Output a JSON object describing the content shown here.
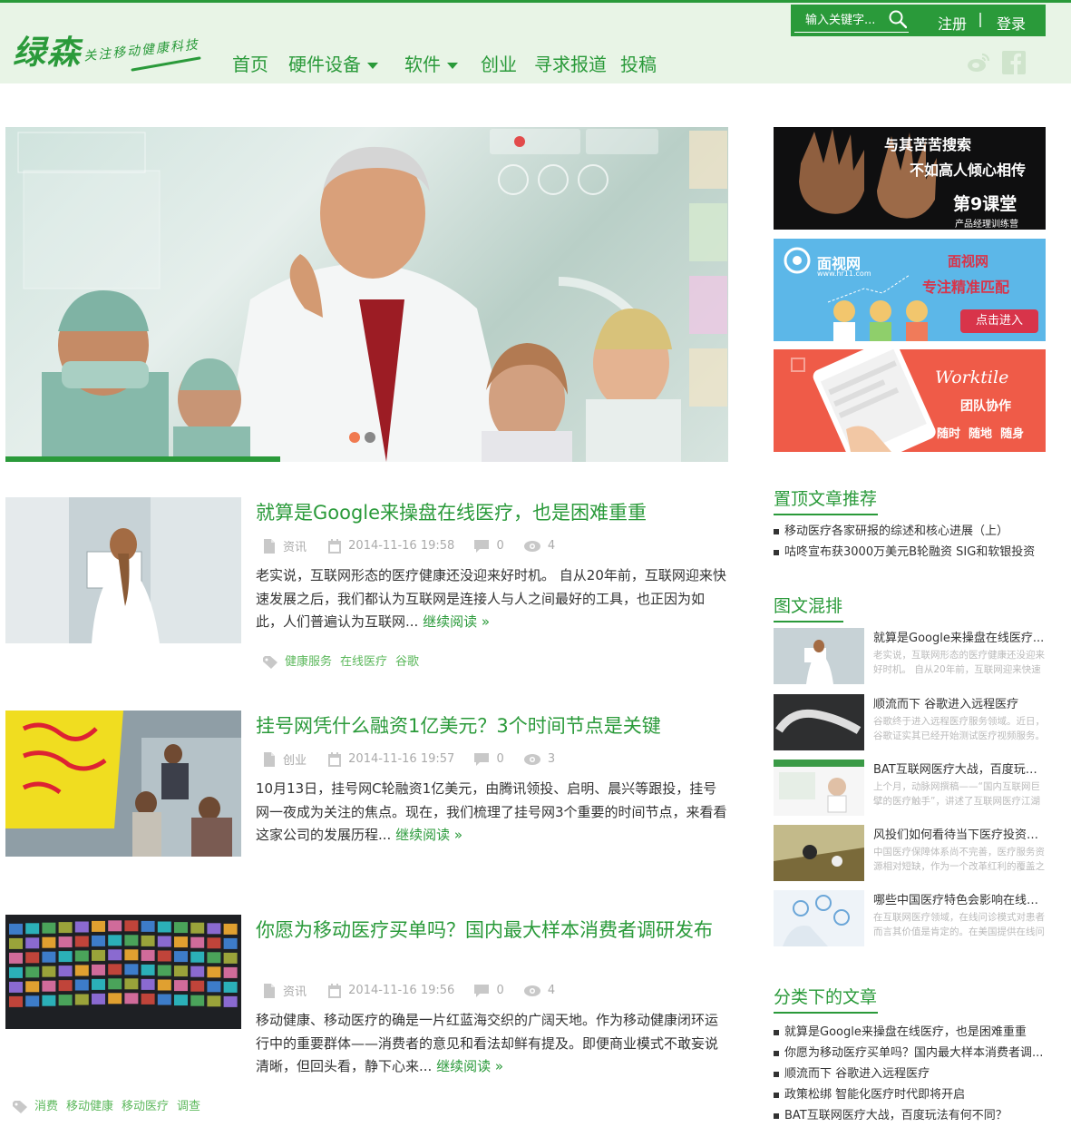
{
  "brand": {
    "name": "绿森",
    "tagline": "关注移动健康科技"
  },
  "nav": [
    {
      "label": "首页"
    },
    {
      "label": "硬件设备"
    },
    {
      "label": "软件"
    },
    {
      "label": "创业"
    },
    {
      "label": "寻求报道"
    },
    {
      "label": "投稿"
    }
  ],
  "search": {
    "placeholder": "输入关键字..."
  },
  "auth": {
    "register": "注册",
    "login": "登录"
  },
  "colors": {
    "accent": "#2a9a3a",
    "header_bg": "#e8f4e6",
    "tag": "#5cb85c"
  },
  "slider": {
    "progress": 0.38,
    "active_index": 0,
    "count": 2
  },
  "posts": [
    {
      "title": "就算是Google来操盘在线医疗，也是困难重重",
      "category": "资讯",
      "date": "2014-11-16 19:58",
      "comments": "0",
      "views": "4",
      "excerpt": "老实说，互联网形态的医疗健康还没迎来好时机。 自从20年前，互联网迎来快速发展之后，我们都认为互联网是连接人与人之间最好的工具，也正因为如此，人们普遍认为互联网...",
      "readmore": "继续阅读 »",
      "tags": [
        "健康服务",
        "在线医疗",
        "谷歌"
      ]
    },
    {
      "title": "挂号网凭什么融资1亿美元？3个时间节点是关键",
      "category": "创业",
      "date": "2014-11-16 19:57",
      "comments": "0",
      "views": "3",
      "excerpt": "10月13日，挂号网C轮融资1亿美元，由腾讯领投、启明、晨兴等跟投，挂号网一夜成为关注的焦点。现在，我们梳理了挂号网3个重要的时间节点，来看看这家公司的发展历程...",
      "readmore": "继续阅读 »",
      "tags": []
    },
    {
      "title": "你愿为移动医疗买单吗？国内最大样本消费者调研发布",
      "category": "资讯",
      "date": "2014-11-16 19:56",
      "comments": "0",
      "views": "4",
      "excerpt": "移动健康、移动医疗的确是一片红蓝海交织的广阔天地。作为移动健康闭环运行中的重要群体——消费者的意见和看法却鲜有提及。即便商业模式不敢妄说清晰，但回头看，静下心来...",
      "readmore": "继续阅读 »",
      "tags": [
        "消费",
        "移动健康",
        "移动医疗",
        "调查"
      ]
    }
  ],
  "ads": [
    {
      "line1": "与其苦苦搜索",
      "line2": "不如高人倾心相传",
      "line3": "第9课堂",
      "line4": "产品经理训练营"
    },
    {
      "line1": "面视网",
      "line2": "www.hr11.com",
      "line3": "面视网",
      "line4": "专注精准匹配",
      "line5": "点击进入"
    },
    {
      "line1": "Worktile",
      "line2": "团队协作",
      "line3": "随时  随地  随身"
    }
  ],
  "sidebar": {
    "pinned_title": "置顶文章推荐",
    "pinned": [
      "移动医疗各家研报的综述和核心进展（上）",
      "咕咚宣布获3000万美元B轮融资 SIG和软银投资"
    ],
    "mix_title": "图文混排",
    "mix": [
      {
        "title": "就算是Google来操盘在线医疗...",
        "excerpt": "老实说，互联网形态的医疗健康还没迎来好时机。 自从20年前，互联网迎来快速发"
      },
      {
        "title": "顺流而下 谷歌进入远程医疗",
        "excerpt": "谷歌终于进入远程医疗服务领域。近日，谷歌证实其已经开始测试医疗视频服务。这项"
      },
      {
        "title": "BAT互联网医疗大战，百度玩法...",
        "excerpt": "上个月，动脉网撰稿——“国内互联网巨擘的医疗触手”，讲述了互联网医疗江湖"
      },
      {
        "title": "风投们如何看待当下医疗投资机...",
        "excerpt": "中国医疗保障体系尚不完善，医疗服务资源相对短缺，作为一个改革红利的覆盖之"
      },
      {
        "title": "哪些中国医疗特色会影响在线问...",
        "excerpt": "在互联网医疗领域，在线问诊模式对患者而言其价值是肯定的。在美国提供在线问"
      }
    ],
    "cat_title": "分类下的文章",
    "cat": [
      "就算是Google来操盘在线医疗，也是困难重重",
      "你愿为移动医疗买单吗？国内最大样本消费者调...",
      "顺流而下 谷歌进入远程医疗",
      "政策松绑 智能化医疗时代即将开启",
      "BAT互联网医疗大战，百度玩法有何不同？"
    ]
  }
}
